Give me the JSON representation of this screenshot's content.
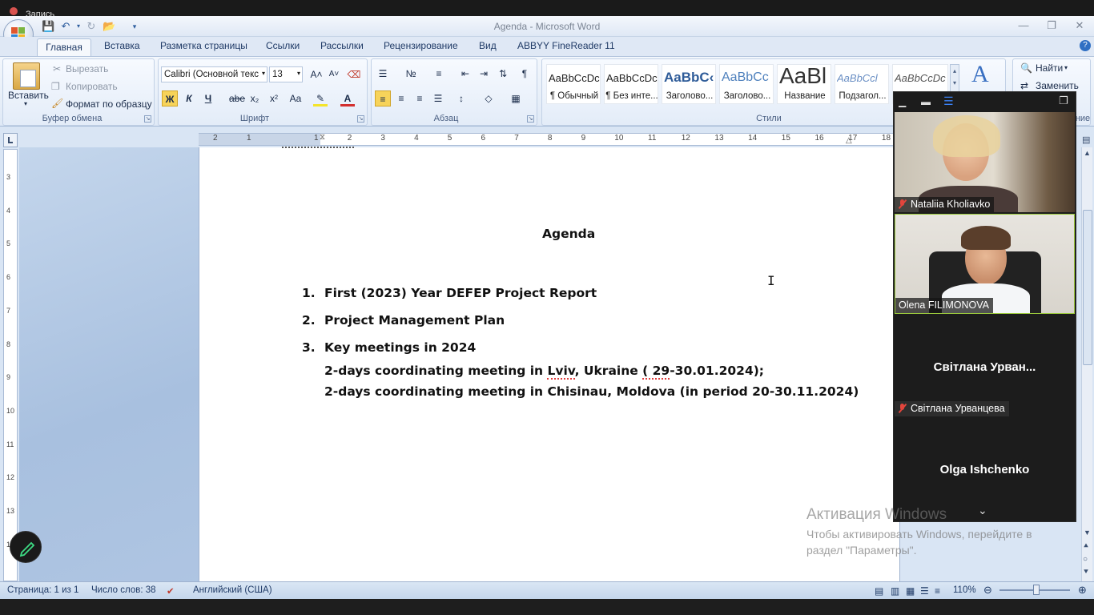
{
  "recording_label": "Запись",
  "window": {
    "title": "Agenda - Microsoft Word"
  },
  "tabs": [
    "Главная",
    "Вставка",
    "Разметка страницы",
    "Ссылки",
    "Рассылки",
    "Рецензирование",
    "Вид",
    "ABBYY FineReader 11"
  ],
  "clipboard": {
    "paste": "Вставить",
    "cut": "Вырезать",
    "copy": "Копировать",
    "format_painter": "Формат по образцу",
    "label": "Буфер обмена"
  },
  "font": {
    "name": "Calibri (Основной текс",
    "size": "13",
    "label": "Шрифт",
    "bold": "Ж",
    "italic": "К",
    "underline": "Ч",
    "strike": "abe",
    "sub": "x₂",
    "sup": "x²",
    "case": "Aa"
  },
  "paragraph": {
    "label": "Абзац"
  },
  "styles": {
    "label": "Стили",
    "items": [
      {
        "preview": "AaBbCcDc",
        "name": "¶ Обычный",
        "color": "#222222"
      },
      {
        "preview": "AaBbCcDc",
        "name": "¶ Без инте...",
        "color": "#222222"
      },
      {
        "preview": "AaBbC‹",
        "name": "Заголово...",
        "color": "#2f5c99"
      },
      {
        "preview": "AaBbCc",
        "name": "Заголово...",
        "color": "#4f81bd"
      },
      {
        "preview": "AaBl",
        "name": "Название",
        "color": "#333333"
      },
      {
        "preview": "AaBbCcl",
        "name": "Подзагол...",
        "color": "#6a8fc4"
      },
      {
        "preview": "AaBbCcDc",
        "name": "",
        "color": "#555555"
      }
    ]
  },
  "editing": {
    "find": "Найти",
    "replace": "Заменить",
    "label_fragment": "ние"
  },
  "ruler_numbers": [
    "2",
    "1",
    "1",
    "2",
    "3",
    "4",
    "5",
    "6",
    "7",
    "8",
    "9",
    "10",
    "11",
    "12",
    "13",
    "14",
    "15",
    "16",
    "17",
    "18"
  ],
  "vruler_numbers": [
    "3",
    "4",
    "5",
    "6",
    "7",
    "8",
    "9",
    "10",
    "11",
    "12",
    "13",
    "14"
  ],
  "document": {
    "title": "Agenda",
    "items": [
      {
        "num": "1.",
        "text": "First (2023) Year DEFEP Project Report"
      },
      {
        "num": "2.",
        "text": "Project Management Plan"
      },
      {
        "num": "3.",
        "text": "Key meetings in 2024"
      }
    ],
    "sub1_a": "2-days coordinating meeting in ",
    "sub1_b": "Lviv",
    "sub1_c": ", Ukraine ",
    "sub1_d": "( 29",
    "sub1_e": "-30.01.2024);",
    "sub2": "2-days coordinating meeting in Chisinau, Moldova (in period 20-30.11.2024)"
  },
  "status": {
    "page": "Страница: 1 из 1",
    "words": "Число слов: 38",
    "language": "Английский (США)",
    "zoom": "110%"
  },
  "video": {
    "participants": [
      {
        "name": "Nataliia Kholiavko",
        "muted": true
      },
      {
        "name": "Olena FILIMONOVA",
        "muted": false
      },
      {
        "name": "Світлана Урван...",
        "name_full": "Світлана Урванцева",
        "muted": true
      },
      {
        "name": "Olga Ishchenko",
        "muted": false
      }
    ]
  },
  "activation": {
    "title": "Активация Windows",
    "subtitle": "Чтобы активировать Windows, перейдите в раздел \"Параметры\"."
  }
}
